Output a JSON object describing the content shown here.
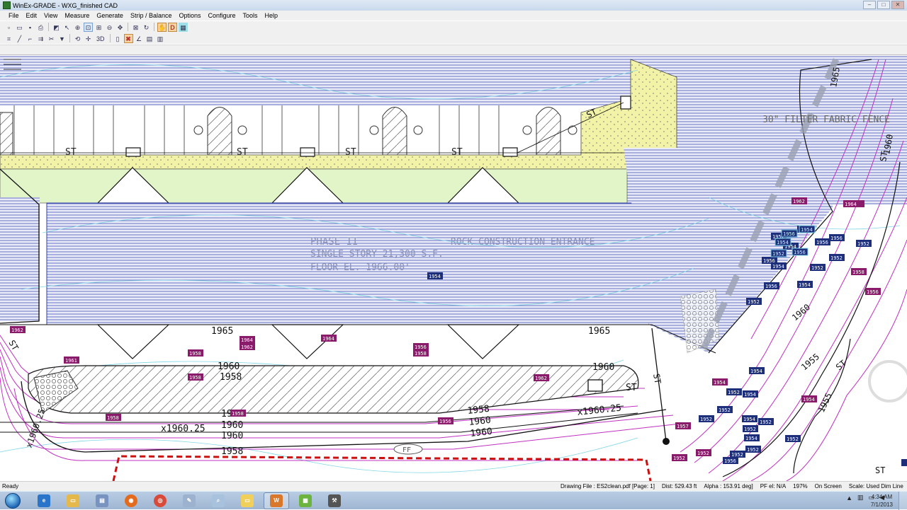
{
  "window": {
    "title": "WinEx-GRADE - WXG_finished CAD"
  },
  "window_controls": {
    "minimize": "–",
    "maximize": "□",
    "close": "✕"
  },
  "menu": [
    "File",
    "Edit",
    "View",
    "Measure",
    "Generate",
    "Strip / Balance",
    "Options",
    "Configure",
    "Tools",
    "Help"
  ],
  "toolbar": {
    "label_3d": "3D",
    "label_d": "D"
  },
  "drawing": {
    "phase_text": "PHASE II",
    "building_text": "SINGLE STORY 21,300 S.F.",
    "floor_text": "FLOOR EL. 1966.00'",
    "rock_entrance": "ROCK CONSTRUCTION ENTRANCE",
    "fence_note": "30\" FILTER FABRIC FENCE",
    "storm_tag": "ST",
    "fire_hydrant_tag": "FF",
    "contours": {
      "c1965": "1965",
      "c1960": "1960",
      "c1958": "1958",
      "c1955": "1955",
      "spot_1960_25": "x1960.25"
    },
    "elevation_tags": [
      "1962",
      "1964",
      "1962",
      "1961",
      "1958",
      "1958",
      "1958",
      "1964",
      "1956",
      "1958",
      "1962",
      "1956",
      "1958",
      "1954",
      "1956",
      "1952",
      "1956",
      "1954",
      "1952",
      "1956",
      "1958",
      "1954",
      "1956",
      "1957",
      "1952",
      "1954",
      "1952",
      "1962",
      "1964"
    ],
    "cyan_tags": [
      "1954",
      "1956",
      "1954",
      "1952",
      "1956"
    ]
  },
  "status": {
    "ready": "Ready",
    "drawing_file": "Drawing File : ES2clean.pdf [Page: 1]",
    "dist": "Dist: 529.43 ft",
    "alpha": "Alpha : 153.91 deg]",
    "pf_el": "PF el: N/A",
    "zoom": "197%",
    "on_screen": "On Screen",
    "scale": "Scale: Used Dim Line"
  },
  "taskbar": {
    "tasks": [
      "ie",
      "explorer",
      "doc",
      "firefox",
      "chrome",
      "pen",
      "search",
      "folder",
      "winexgrade",
      "green",
      "tool"
    ],
    "clock_time": "4:34 AM",
    "clock_date": "7/1/2013"
  },
  "colors": {
    "hatch_blue": "#2f3fa8",
    "contour_magenta": "#c030c0",
    "pad_yellow": "#f2f3a6",
    "pad_green": "#e2f5c9",
    "red_dashed": "#cc1010",
    "cyan_grade": "#7fd6e6"
  }
}
